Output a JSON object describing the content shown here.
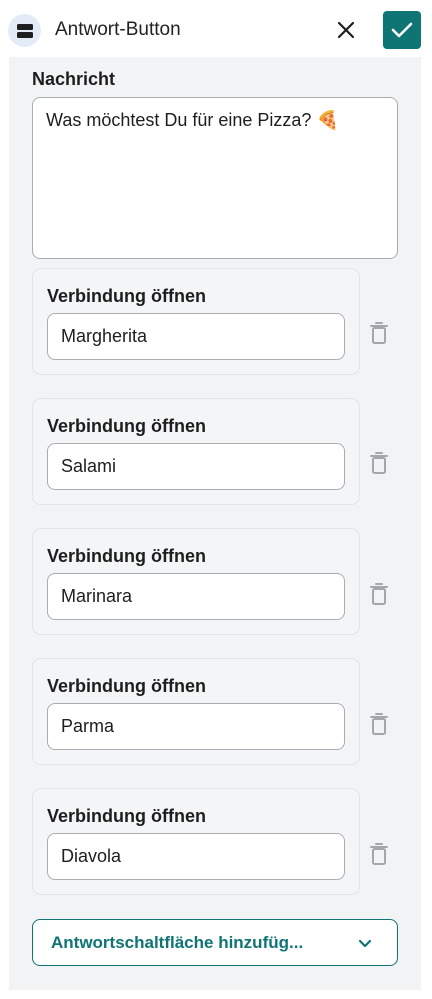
{
  "header": {
    "icon": "block-icon",
    "title": "Antwort-Button",
    "close_icon": "close-icon",
    "confirm_icon": "check-icon"
  },
  "message": {
    "label": "Nachricht",
    "text": "Was möchtest Du für eine Pizza? 🍕"
  },
  "answers": [
    {
      "title": "Verbindung öffnen",
      "value": "Margherita"
    },
    {
      "title": "Verbindung öffnen",
      "value": "Salami"
    },
    {
      "title": "Verbindung öffnen",
      "value": "Marinara"
    },
    {
      "title": "Verbindung öffnen",
      "value": "Parma"
    },
    {
      "title": "Verbindung öffnen",
      "value": "Diavola"
    }
  ],
  "add_button": {
    "label": "Antwortschaltfläche hinzufüg...",
    "icon": "chevron-down-icon"
  },
  "colors": {
    "accent": "#0f7474",
    "panel": "#f1f3f5",
    "icon_bg": "#e3ecf6"
  }
}
